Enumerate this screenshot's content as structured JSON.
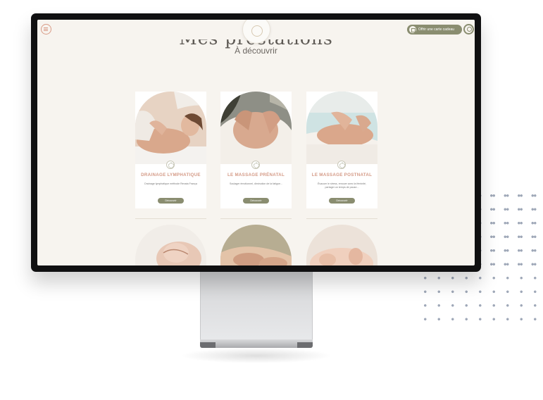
{
  "header": {
    "gift_label": "Offrir une carte cadeau"
  },
  "page": {
    "title": "Mes prestations",
    "subtitle": "À découvrir"
  },
  "cards": [
    {
      "title": "DRAINAGE LYMPHATIQUE",
      "description": "Drainage lymphatique méthode Renata França",
      "button": "Découvrir"
    },
    {
      "title": "LE MASSAGE PRÉNATAL",
      "description": "Soulager émotionnel, diminution de la fatigue...",
      "button": "Découvrir"
    },
    {
      "title": "LE MASSAGE POSTNATAL",
      "description": "Évacuer le stress, renouer avec la féminité, partager un temps de pause...",
      "button": "Découvrir"
    }
  ],
  "colors": {
    "accent": "#d49a86",
    "olive": "#8a8d70",
    "background": "#f7f4ef"
  }
}
